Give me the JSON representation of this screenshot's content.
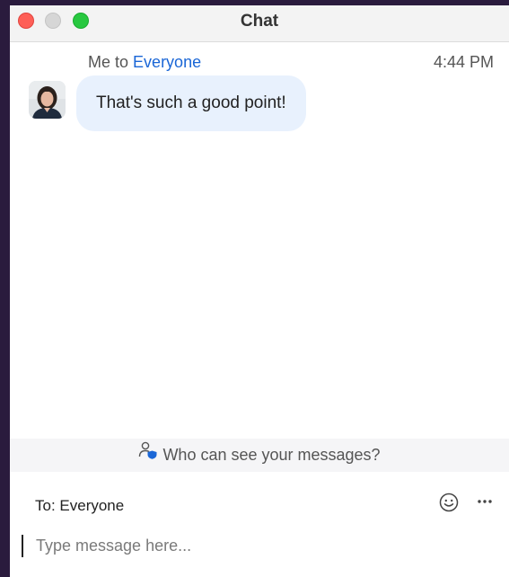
{
  "window": {
    "title": "Chat",
    "traffic_lights": [
      "close",
      "minimize",
      "maximize"
    ]
  },
  "message": {
    "sender": "Me to",
    "recipient": "Everyone",
    "time": "4:44 PM",
    "text": "That's such a good point!",
    "avatar_icon": "user-avatar-photo"
  },
  "privacy": {
    "icon": "person-shield-icon",
    "label": "Who can see your messages?"
  },
  "composer": {
    "to_label": "To: Everyone",
    "placeholder": "Type message here...",
    "value": "",
    "emoji_icon": "smiley-icon",
    "more_icon": "ellipsis-icon"
  },
  "colors": {
    "accent": "#1a66d6",
    "bubble": "#e8f1fd",
    "close": "#fe5f57",
    "maximize": "#28c840"
  }
}
